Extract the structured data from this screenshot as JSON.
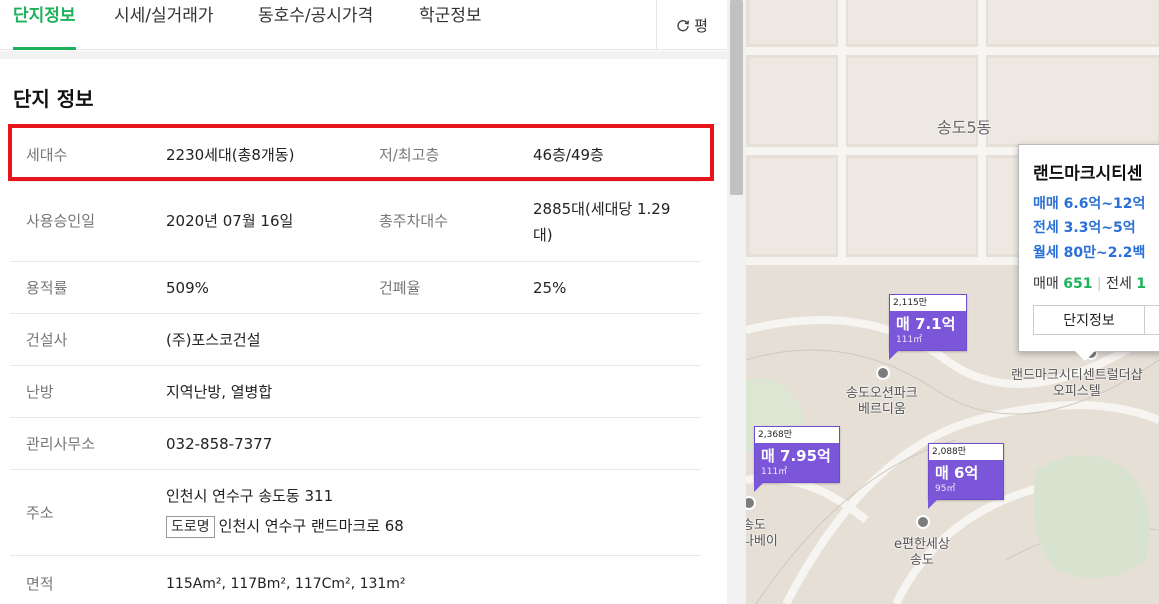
{
  "tabs": [
    {
      "label": "단지정보",
      "active": true
    },
    {
      "label": "시세/실거래가",
      "active": false
    },
    {
      "label": "동호수/공시가격",
      "active": false
    },
    {
      "label": "학군정보",
      "active": false
    }
  ],
  "pyeong_button": {
    "label": "평"
  },
  "section_title": "단지 정보",
  "info": {
    "households_label": "세대수",
    "households_value": "2230세대(총8개동)",
    "floors_label": "저/최고층",
    "floors_value": "46층/49층",
    "approval_label": "사용승인일",
    "approval_value": "2020년 07월 16일",
    "parking_label": "총주차대수",
    "parking_value_line1": "2885대(세대당 1.29",
    "parking_value_line2": "대)",
    "far_label": "용적률",
    "far_value": "509%",
    "bcr_label": "건폐율",
    "bcr_value": "25%",
    "builder_label": "건설사",
    "builder_value": "(주)포스코건설",
    "heating_label": "난방",
    "heating_value": "지역난방, 열병합",
    "office_label": "관리사무소",
    "office_value": "032-858-7377",
    "address_label": "주소",
    "address_value": "인천시 연수구 송도동 311",
    "road_tag": "도로명",
    "road_value": "인천시 연수구 랜드마크로 68",
    "area_label": "면적",
    "area_value": "115Am², 117Bm², 117Cm², 131m²"
  },
  "map": {
    "district_label": "송도5동",
    "markers": [
      {
        "pp": "2,115만",
        "price": "매 7.1억",
        "area": "111㎡"
      },
      {
        "pp": "2,368만",
        "price": "매 7.95억",
        "area": "111㎡"
      },
      {
        "pp": "2,088만",
        "price": "매 6억",
        "area": "95㎡"
      }
    ],
    "pois": [
      {
        "line1": "송도오션파크",
        "line2": "베르디움"
      },
      {
        "line1": "랜드마크시티센트럴더샵",
        "line2": "오피스텔"
      },
      {
        "line1": "e편한세상",
        "line2": "송도"
      },
      {
        "line1": "송도",
        "line2": "나베이"
      }
    ],
    "popup": {
      "title": "랜드마크시티센",
      "sale": "매매 6.6억~12억",
      "jeonse": "전세 3.3억~5억",
      "monthly": "월세 80만~2.2백",
      "count_sale_label": "매매",
      "count_sale": "651",
      "count_jeonse_label": "전세",
      "count_jeonse": "1",
      "button": "단지정보"
    }
  }
}
